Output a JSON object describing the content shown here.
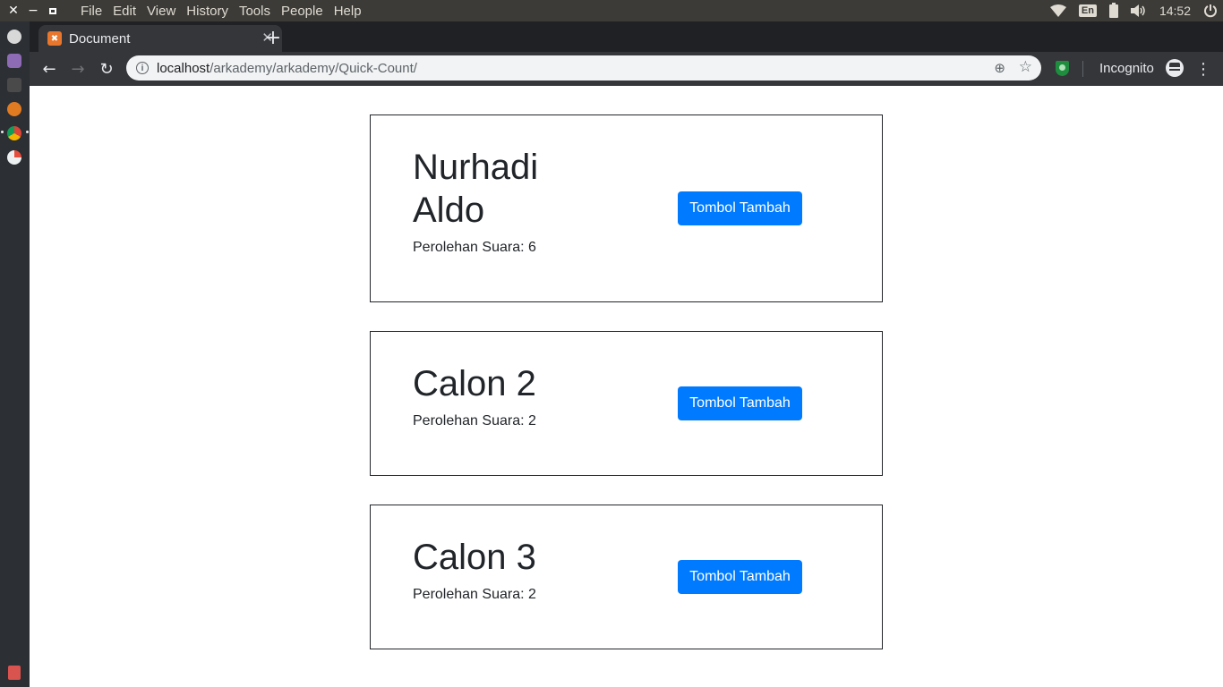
{
  "os_menubar": {
    "menus": [
      "File",
      "Edit",
      "View",
      "History",
      "Tools",
      "People",
      "Help"
    ],
    "language": "En",
    "clock": "14:52"
  },
  "browser": {
    "tab_title": "Document",
    "url_host": "localhost",
    "url_path": "/arkademy/arkademy/Quick-Count/",
    "incognito_label": "Incognito"
  },
  "candidates": [
    {
      "name_line1": "Nurhadi",
      "name_line2": "Aldo",
      "votes_label": "Perolehan Suara: 6",
      "votes": 6,
      "button_label": "Tombol Tambah"
    },
    {
      "name_line1": "Calon 2",
      "votes_label": "Perolehan Suara: 2",
      "votes": 2,
      "button_label": "Tombol Tambah"
    },
    {
      "name_line1": "Calon 3",
      "votes_label": "Perolehan Suara: 2",
      "votes": 2,
      "button_label": "Tombol Tambah"
    }
  ],
  "colors": {
    "primary_button": "#007bff",
    "menubar": "#3c3b37",
    "launcher": "#2c2f33",
    "browser_frame": "#202124",
    "toolbar": "#35363a"
  },
  "icons": {
    "window_close": "close-icon",
    "window_minimize": "minimize-icon",
    "window_maximize": "maximize-icon",
    "wifi": "wifi-icon",
    "battery": "battery-icon",
    "volume": "volume-icon",
    "power": "power-icon",
    "back": "back-arrow-icon",
    "forward": "forward-arrow-icon",
    "reload": "reload-icon",
    "site_info": "info-icon",
    "zoom": "zoom-icon",
    "bookmark": "star-icon",
    "extension": "shield-icon",
    "incognito": "incognito-icon",
    "menu": "kebab-menu-icon"
  }
}
